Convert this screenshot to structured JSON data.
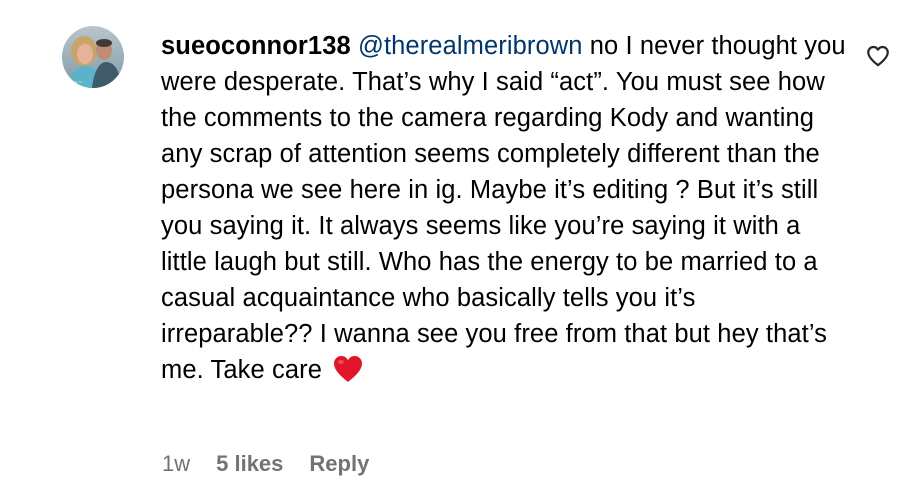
{
  "comment": {
    "username": "sueoconnor138",
    "mention": "@therealmeribrown",
    "text": "no I never thought you were desperate. That’s why I said “act”. You must see how the comments to the camera regarding Kody and wanting any scrap of attention seems completely different than the persona we see here in ig. Maybe it’s editing ? But it’s still you saying it. It always seems like you’re saying it with a little laugh but still. Who has the energy to be married to a casual acquaintance who basically tells you it’s irreparable?? I wanna see you free from that but hey that’s me. Take care",
    "emoji": "red-heart-emoji",
    "avatar_icon": "profile-photo",
    "like_icon": "heart-outline-icon",
    "time_ago": "1w",
    "likes": "5 likes",
    "reply_label": "Reply"
  },
  "colors": {
    "text": "#000000",
    "mention": "#00376b",
    "meta": "#737373",
    "emoji_heart": "#e0152a"
  }
}
